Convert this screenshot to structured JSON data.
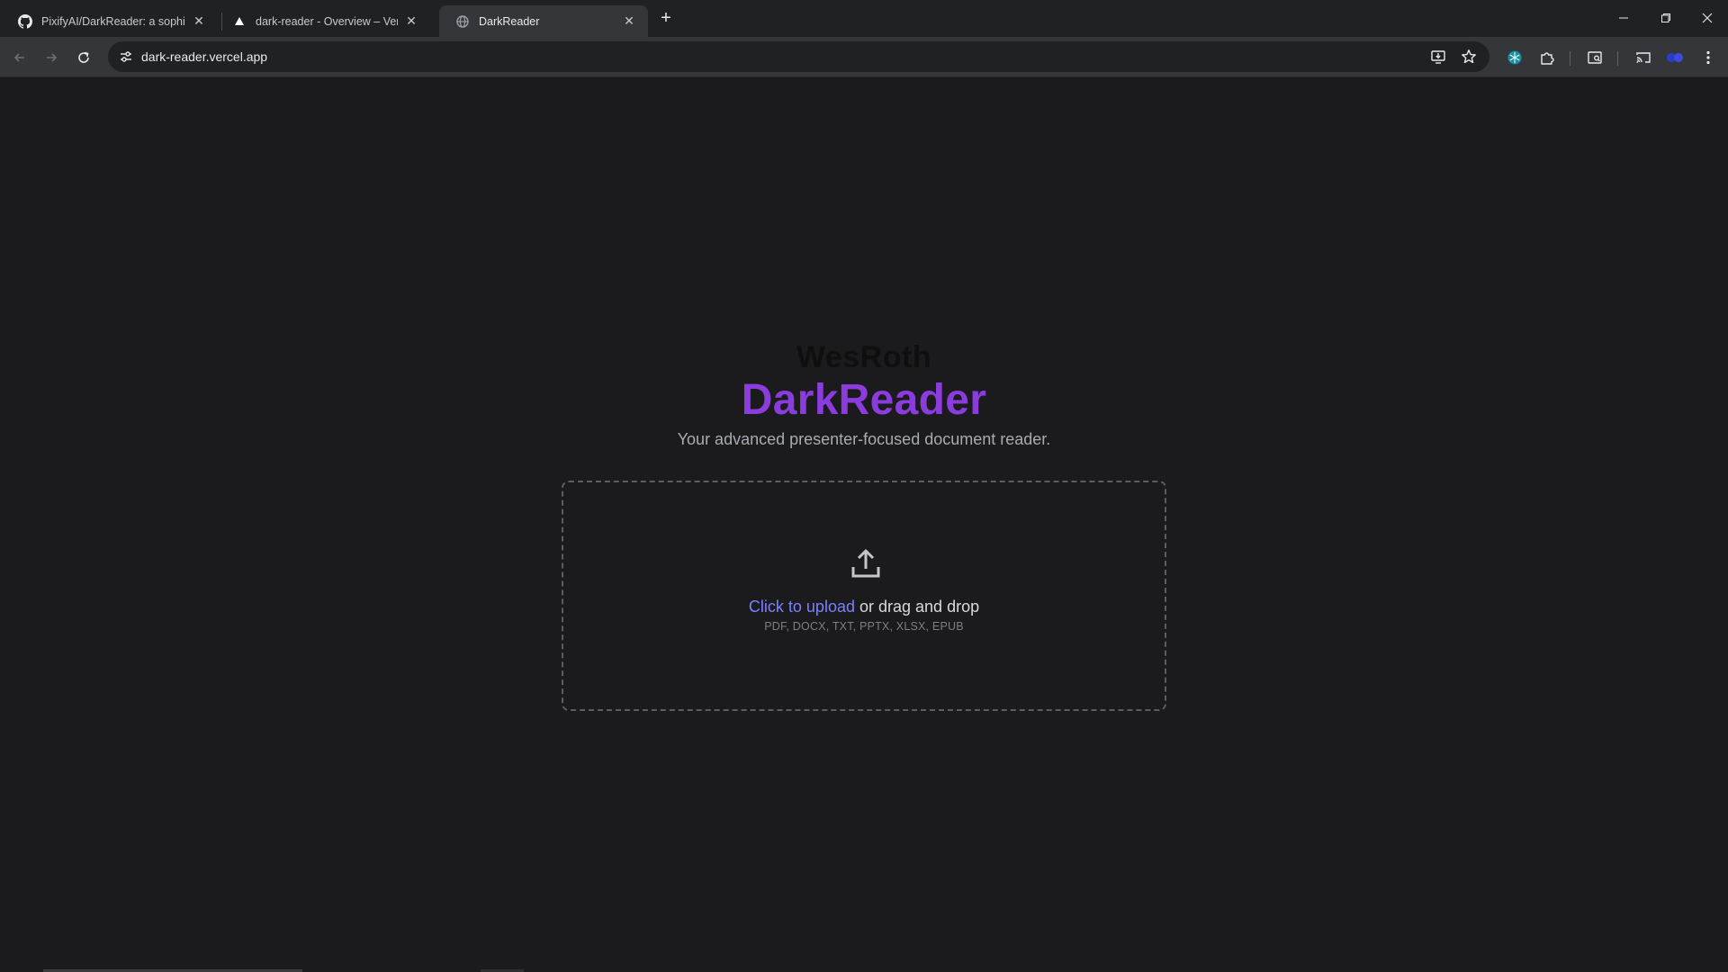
{
  "browser": {
    "tabs": [
      {
        "title": "PixifyAI/DarkReader: a sophistic",
        "icon": "github-icon",
        "active": false
      },
      {
        "title": "dark-reader - Overview – Vercel",
        "icon": "vercel-icon",
        "active": false
      },
      {
        "title": "DarkReader",
        "icon": "globe-icon",
        "active": true
      }
    ],
    "url": "dark-reader.vercel.app"
  },
  "page": {
    "brand": "WesRoth",
    "title": "DarkReader",
    "tagline": "Your advanced presenter-focused document reader.",
    "upload": {
      "link_text": "Click to upload",
      "rest_text": "or drag and drop",
      "formats": "PDF, DOCX, TXT, PPTX, XLSX, EPUB"
    }
  },
  "colors": {
    "accent": "#8a3ddc",
    "link": "#7b80ff",
    "background": "#1b1b1d"
  }
}
